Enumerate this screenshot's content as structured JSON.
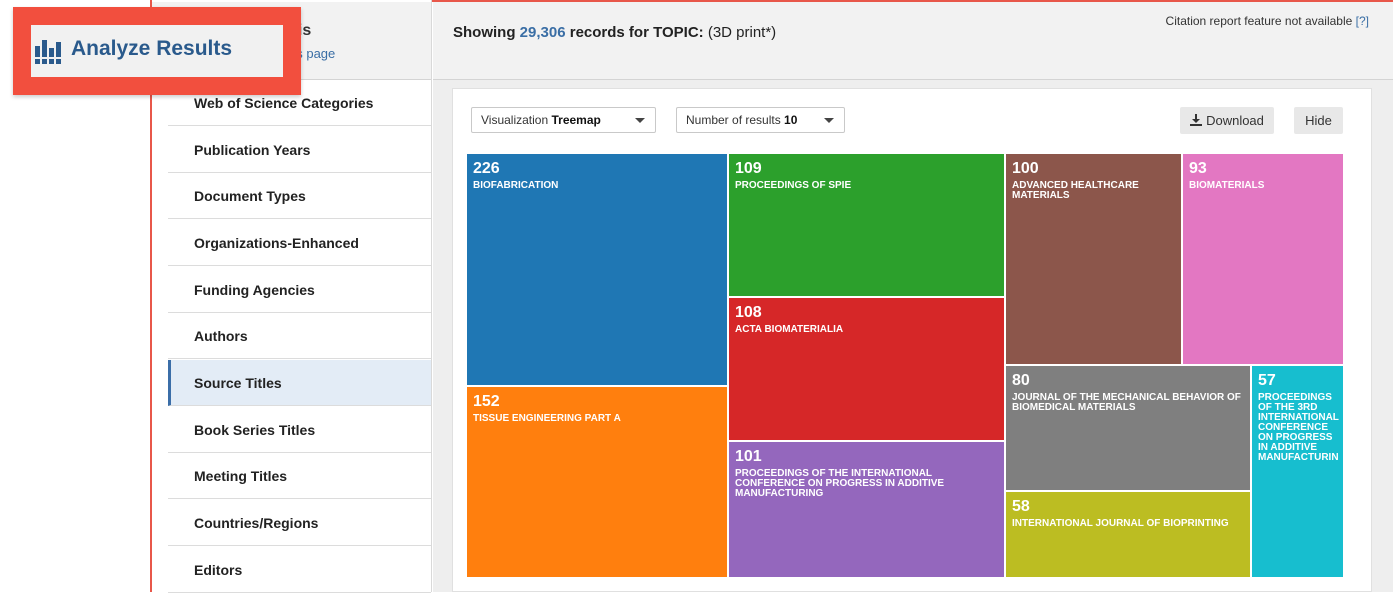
{
  "callout": {
    "title": "Analyze Results",
    "icon": "bar-chart-icon"
  },
  "sidebar": {
    "header_title": "sis",
    "header_link": "us page",
    "items": [
      {
        "label": "Web of Science Categories"
      },
      {
        "label": "Publication Years"
      },
      {
        "label": "Document Types"
      },
      {
        "label": "Organizations-Enhanced"
      },
      {
        "label": "Funding Agencies"
      },
      {
        "label": "Authors"
      },
      {
        "label": "Source Titles",
        "active": true
      },
      {
        "label": "Book Series Titles"
      },
      {
        "label": "Meeting Titles"
      },
      {
        "label": "Countries/Regions"
      },
      {
        "label": "Editors"
      }
    ]
  },
  "header": {
    "showing_prefix": "Showing",
    "record_count": "29,306",
    "showing_middle": "records for TOPIC:",
    "query": "(3D print*)",
    "citation_note": "Citation report feature not available",
    "citation_help": "[?]"
  },
  "controls": {
    "visualization_label": "Visualization",
    "visualization_value": "Treemap",
    "results_label": "Number of results",
    "results_value": "10",
    "download_label": "Download",
    "download_icon": "download-icon",
    "hide_label": "Hide"
  },
  "colors": {
    "accent": "#3a6ea5",
    "callout_red": "#f24f3e"
  },
  "chart_data": {
    "type": "treemap",
    "items": [
      {
        "label": "BIOFABRICATION",
        "value": 226,
        "color": "#1f77b4"
      },
      {
        "label": "TISSUE ENGINEERING PART A",
        "value": 152,
        "color": "#ff7f0e"
      },
      {
        "label": "PROCEEDINGS OF SPIE",
        "value": 109,
        "color": "#2ca02c"
      },
      {
        "label": "ACTA BIOMATERIALIA",
        "value": 108,
        "color": "#d62728"
      },
      {
        "label": "PROCEEDINGS OF THE INTERNATIONAL CONFERENCE ON PROGRESS IN ADDITIVE MANUFACTURING",
        "value": 101,
        "color": "#9467bd"
      },
      {
        "label": "ADVANCED HEALTHCARE MATERIALS",
        "value": 100,
        "color": "#8c564b"
      },
      {
        "label": "BIOMATERIALS",
        "value": 93,
        "color": "#e377c2"
      },
      {
        "label": "JOURNAL OF THE MECHANICAL BEHAVIOR OF BIOMEDICAL MATERIALS",
        "value": 80,
        "color": "#7f7f7f"
      },
      {
        "label": "INTERNATIONAL JOURNAL OF BIOPRINTING",
        "value": 58,
        "color": "#bcbd22"
      },
      {
        "label": "PROCEEDINGS OF THE 3RD INTERNATIONAL CONFERENCE ON PROGRESS IN ADDITIVE MANUFACTURIN",
        "value": 57,
        "color": "#17becf"
      }
    ]
  }
}
